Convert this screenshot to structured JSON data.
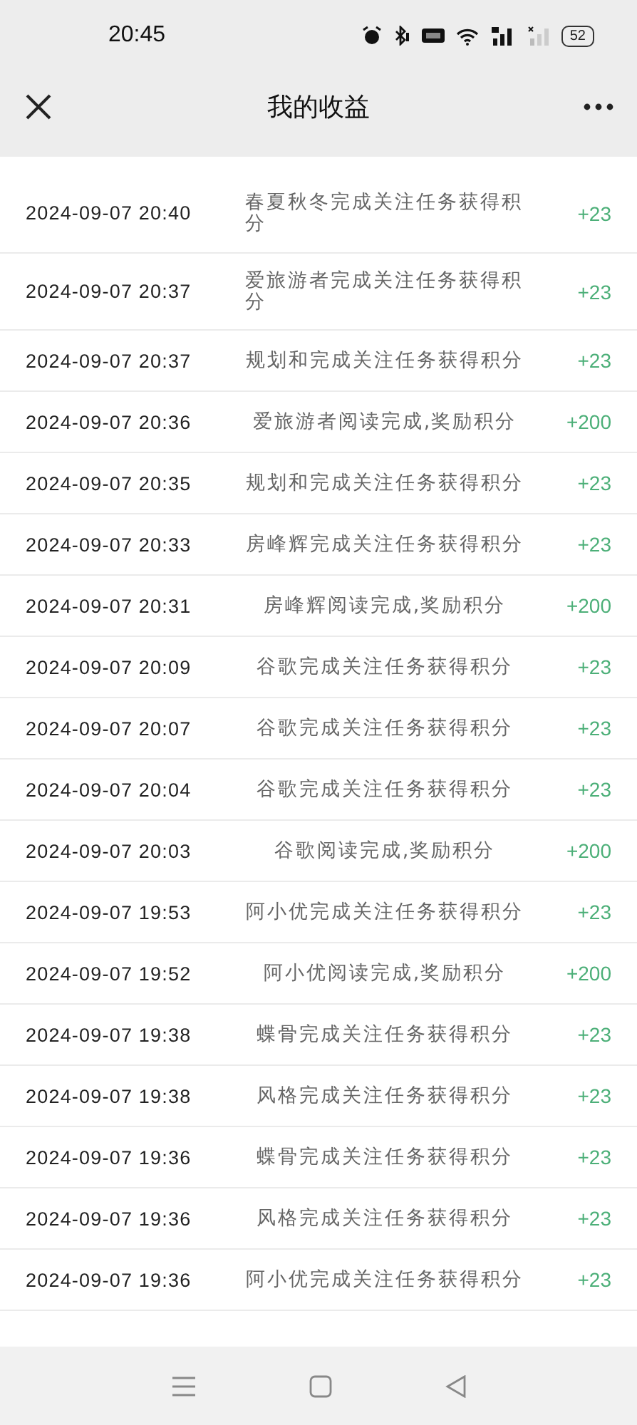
{
  "status_bar": {
    "time": "20:45",
    "battery": "52"
  },
  "header": {
    "title": "我的收益"
  },
  "records": [
    {
      "time": "2024-09-07 20:40",
      "description": "春夏秋冬完成关注任务获得积分",
      "points": "+23"
    },
    {
      "time": "2024-09-07 20:37",
      "description": "爱旅游者完成关注任务获得积分",
      "points": "+23"
    },
    {
      "time": "2024-09-07 20:37",
      "description": "规划和完成关注任务获得积分",
      "points": "+23"
    },
    {
      "time": "2024-09-07 20:36",
      "description": "爱旅游者阅读完成,奖励积分",
      "points": "+200"
    },
    {
      "time": "2024-09-07 20:35",
      "description": "规划和完成关注任务获得积分",
      "points": "+23"
    },
    {
      "time": "2024-09-07 20:33",
      "description": "房峰辉完成关注任务获得积分",
      "points": "+23"
    },
    {
      "time": "2024-09-07 20:31",
      "description": "房峰辉阅读完成,奖励积分",
      "points": "+200"
    },
    {
      "time": "2024-09-07 20:09",
      "description": "谷歌完成关注任务获得积分",
      "points": "+23"
    },
    {
      "time": "2024-09-07 20:07",
      "description": "谷歌完成关注任务获得积分",
      "points": "+23"
    },
    {
      "time": "2024-09-07 20:04",
      "description": "谷歌完成关注任务获得积分",
      "points": "+23"
    },
    {
      "time": "2024-09-07 20:03",
      "description": "谷歌阅读完成,奖励积分",
      "points": "+200"
    },
    {
      "time": "2024-09-07 19:53",
      "description": "阿小优完成关注任务获得积分",
      "points": "+23"
    },
    {
      "time": "2024-09-07 19:52",
      "description": "阿小优阅读完成,奖励积分",
      "points": "+200"
    },
    {
      "time": "2024-09-07 19:38",
      "description": "蝶骨完成关注任务获得积分",
      "points": "+23"
    },
    {
      "time": "2024-09-07 19:38",
      "description": "风格完成关注任务获得积分",
      "points": "+23"
    },
    {
      "time": "2024-09-07 19:36",
      "description": "蝶骨完成关注任务获得积分",
      "points": "+23"
    },
    {
      "time": "2024-09-07 19:36",
      "description": "风格完成关注任务获得积分",
      "points": "+23"
    },
    {
      "time": "2024-09-07 19:36",
      "description": "阿小优完成关注任务获得积分",
      "points": "+23"
    }
  ]
}
